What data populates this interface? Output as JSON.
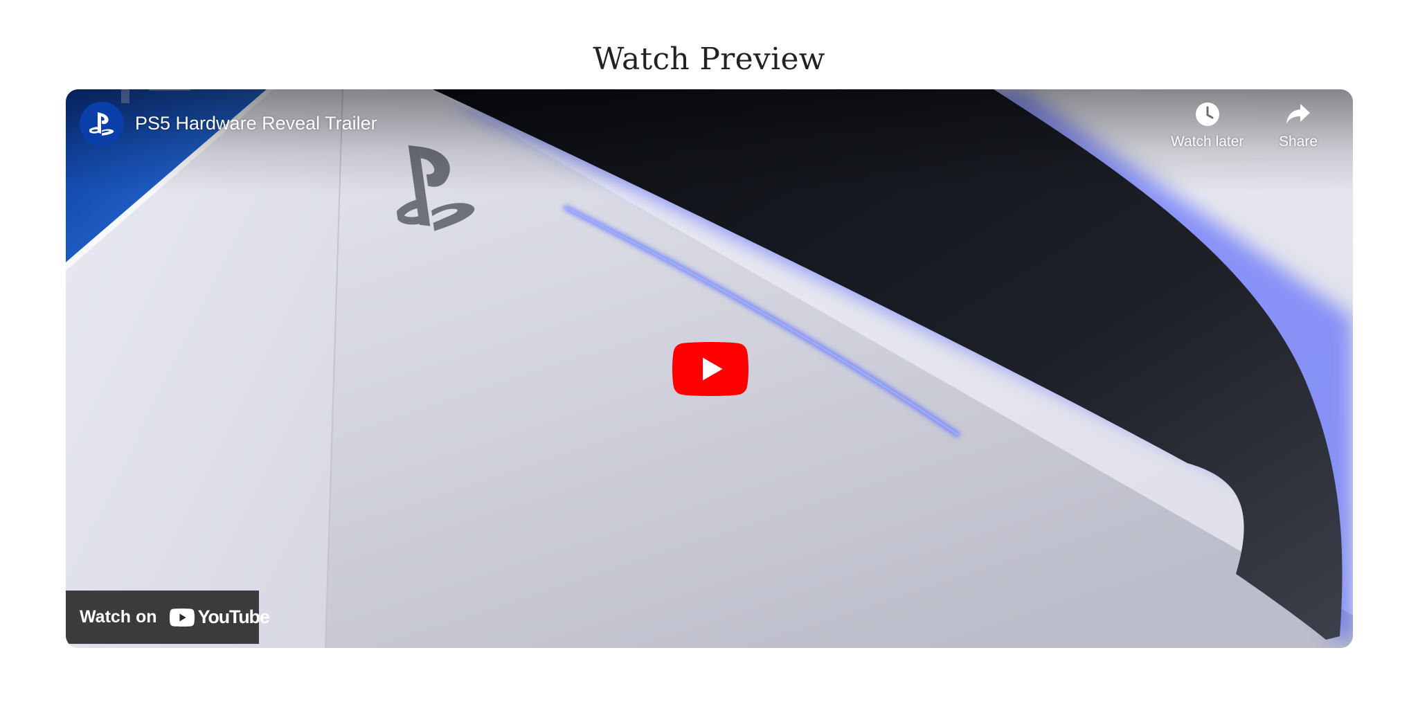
{
  "section": {
    "heading": "Watch Preview"
  },
  "video": {
    "title": "PS5 Hardware Reveal Trailer",
    "channel_icon": "playstation-logo-icon",
    "actions": {
      "watch_later_label": "Watch later",
      "watch_later_icon": "clock-icon",
      "share_label": "Share",
      "share_icon": "share-arrow-icon"
    },
    "play_icon": "youtube-play-icon",
    "watch_on": {
      "label": "Watch on",
      "platform": "YouTube",
      "icon": "youtube-logo-icon"
    }
  },
  "colors": {
    "youtube_red": "#ff0000",
    "channel_blue": "#0a3ea8",
    "accent_glow": "#4b5bff"
  }
}
